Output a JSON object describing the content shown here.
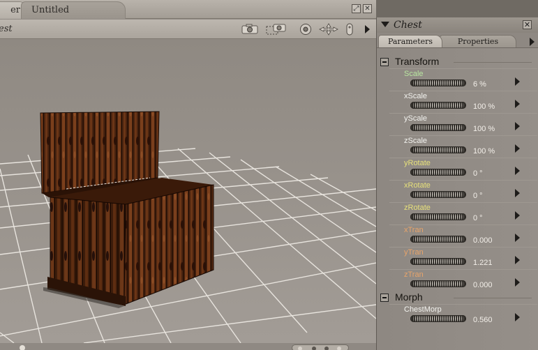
{
  "viewport": {
    "tabs": [
      "er",
      "Untitled"
    ],
    "title": "est"
  },
  "colors": {
    "scale": "#b8e6a0",
    "xscale": "#f2f2ee",
    "rotate": "#e6e07a",
    "tran": "#e8a46a"
  },
  "panel": {
    "title": "Chest",
    "tabs": {
      "parameters": "Parameters",
      "properties": "Properties"
    },
    "groups": [
      {
        "label": "Transform",
        "params": [
          {
            "name": "Scale",
            "value": "6 %",
            "color": "#b8e6a0"
          },
          {
            "name": "xScale",
            "value": "100 %",
            "color": "#f2f2ee"
          },
          {
            "name": "yScale",
            "value": "100 %",
            "color": "#f2f2ee"
          },
          {
            "name": "zScale",
            "value": "100 %",
            "color": "#f2f2ee"
          },
          {
            "name": "yRotate",
            "value": "0 °",
            "color": "#e6e07a"
          },
          {
            "name": "xRotate",
            "value": "0 °",
            "color": "#e6e07a"
          },
          {
            "name": "zRotate",
            "value": "0 °",
            "color": "#e6e07a"
          },
          {
            "name": "xTran",
            "value": "0.000",
            "color": "#e8a46a"
          },
          {
            "name": "yTran",
            "value": "1.221",
            "color": "#e8a46a"
          },
          {
            "name": "zTran",
            "value": "0.000",
            "color": "#e8a46a"
          }
        ]
      },
      {
        "label": "Morph",
        "params": [
          {
            "name": "ChestMorp",
            "value": "0.560",
            "color": "#f2f2ee"
          }
        ]
      }
    ]
  }
}
